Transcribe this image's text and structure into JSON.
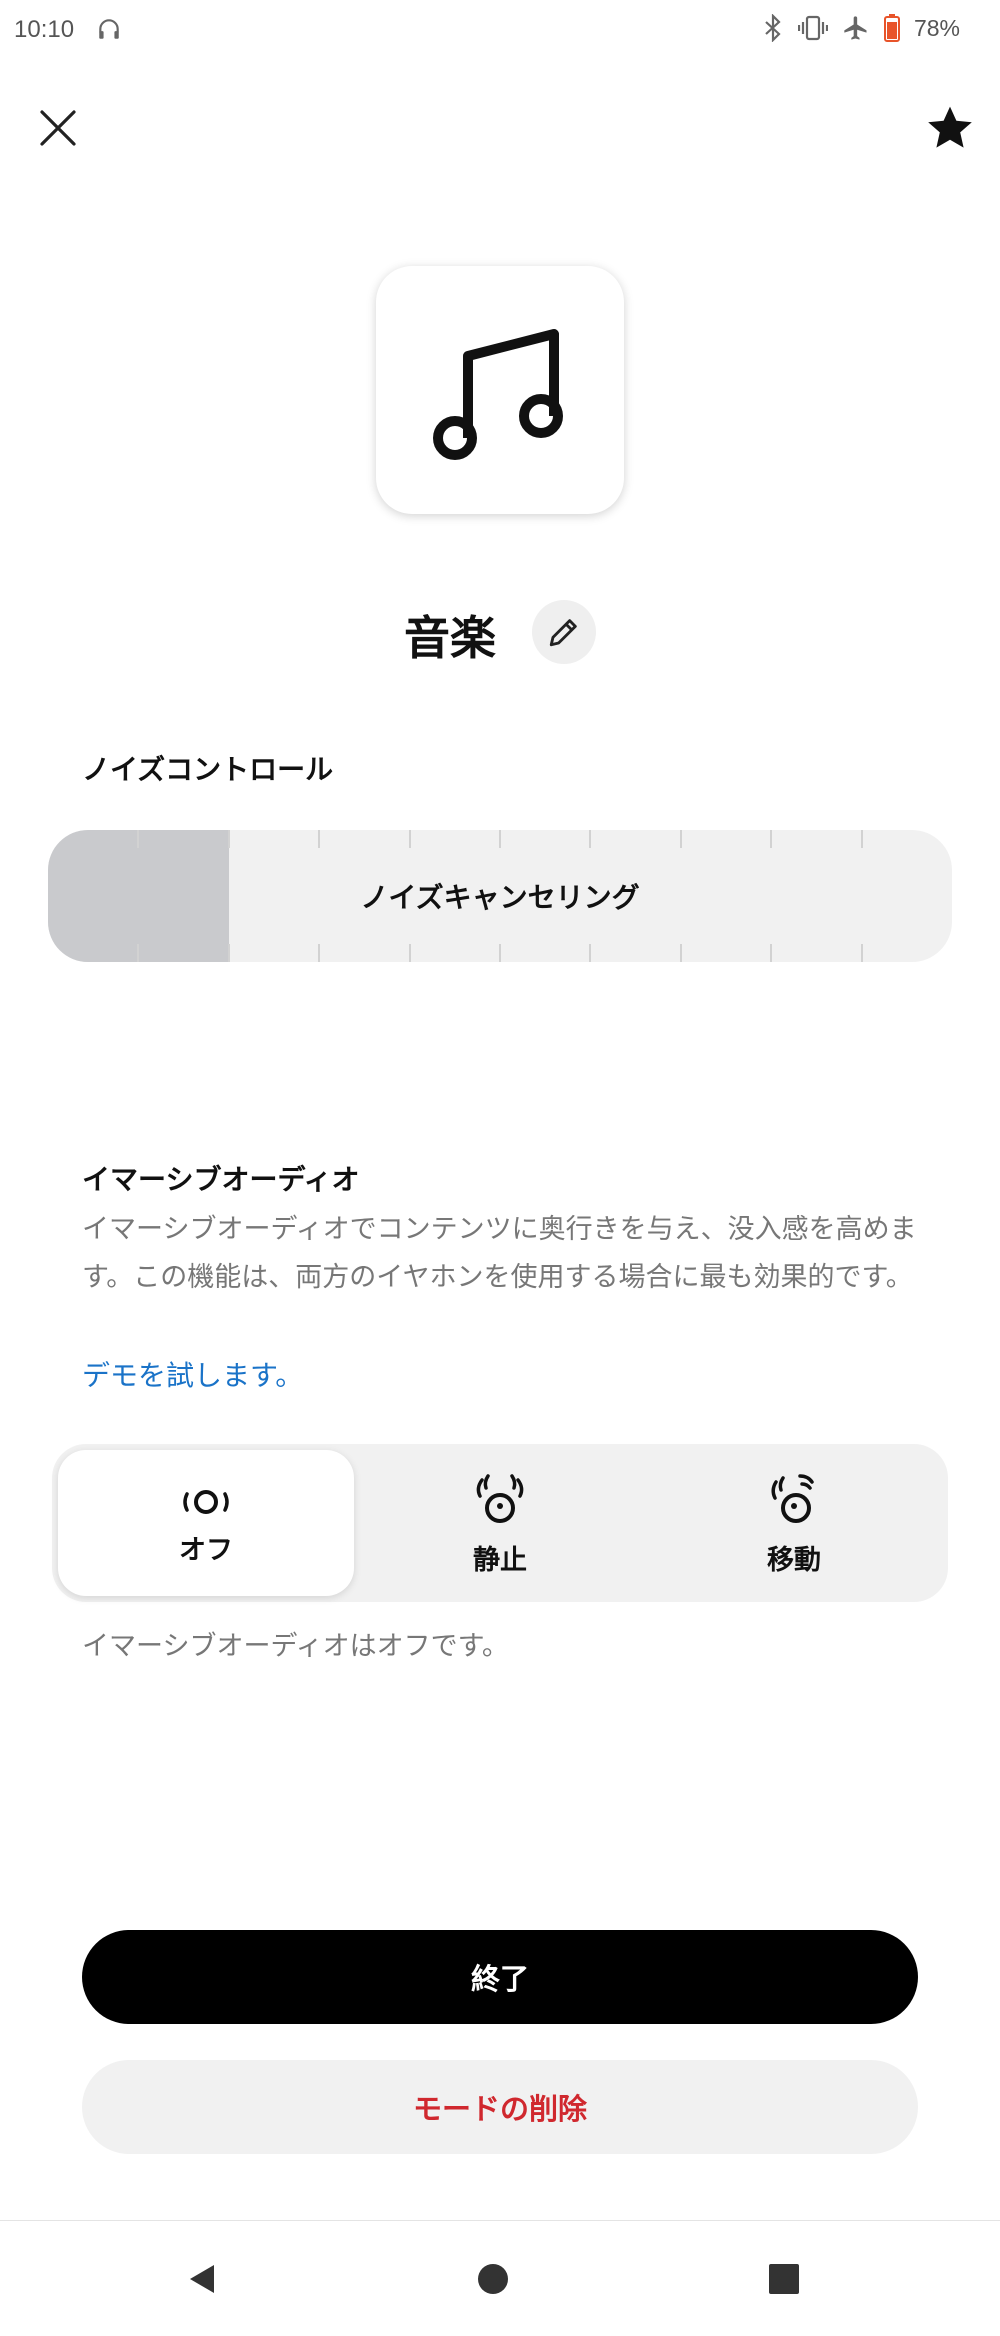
{
  "status_bar": {
    "time": "10:10",
    "battery": "78%",
    "icons": [
      "headphones-icon",
      "bluetooth-icon",
      "vibrate-icon",
      "airplane-icon",
      "battery-icon"
    ]
  },
  "header": {
    "close_icon": "close-icon",
    "favorite_icon": "star-icon"
  },
  "mode": {
    "icon": "music-note-icon",
    "title": "音楽",
    "edit_icon": "pencil-icon"
  },
  "noise_control": {
    "label": "ノイズコントロール",
    "current_setting": "ノイズキャンセリング",
    "level": 0.2,
    "tick_count": 10
  },
  "immersive_audio": {
    "label": "イマーシブオーディオ",
    "description": "イマーシブオーディオでコンテンツに奥行きを与え、没入感を高めます。この機能は、両方のイヤホンを使用する場合に最も効果的です。",
    "demo_link": "デモを試します。",
    "options": [
      {
        "label": "オフ",
        "icon": "audio-off-icon",
        "selected": true
      },
      {
        "label": "静止",
        "icon": "audio-still-icon",
        "selected": false
      },
      {
        "label": "移動",
        "icon": "audio-motion-icon",
        "selected": false
      }
    ],
    "status": "イマーシブオーディオはオフです。"
  },
  "actions": {
    "finish": "終了",
    "delete": "モードの削除"
  },
  "colors": {
    "accent_link": "#1a73c8",
    "danger": "#d0282e",
    "primary_button": "#000000",
    "battery": "#e8542a"
  },
  "nav": [
    "back-icon",
    "home-icon",
    "recents-icon"
  ]
}
